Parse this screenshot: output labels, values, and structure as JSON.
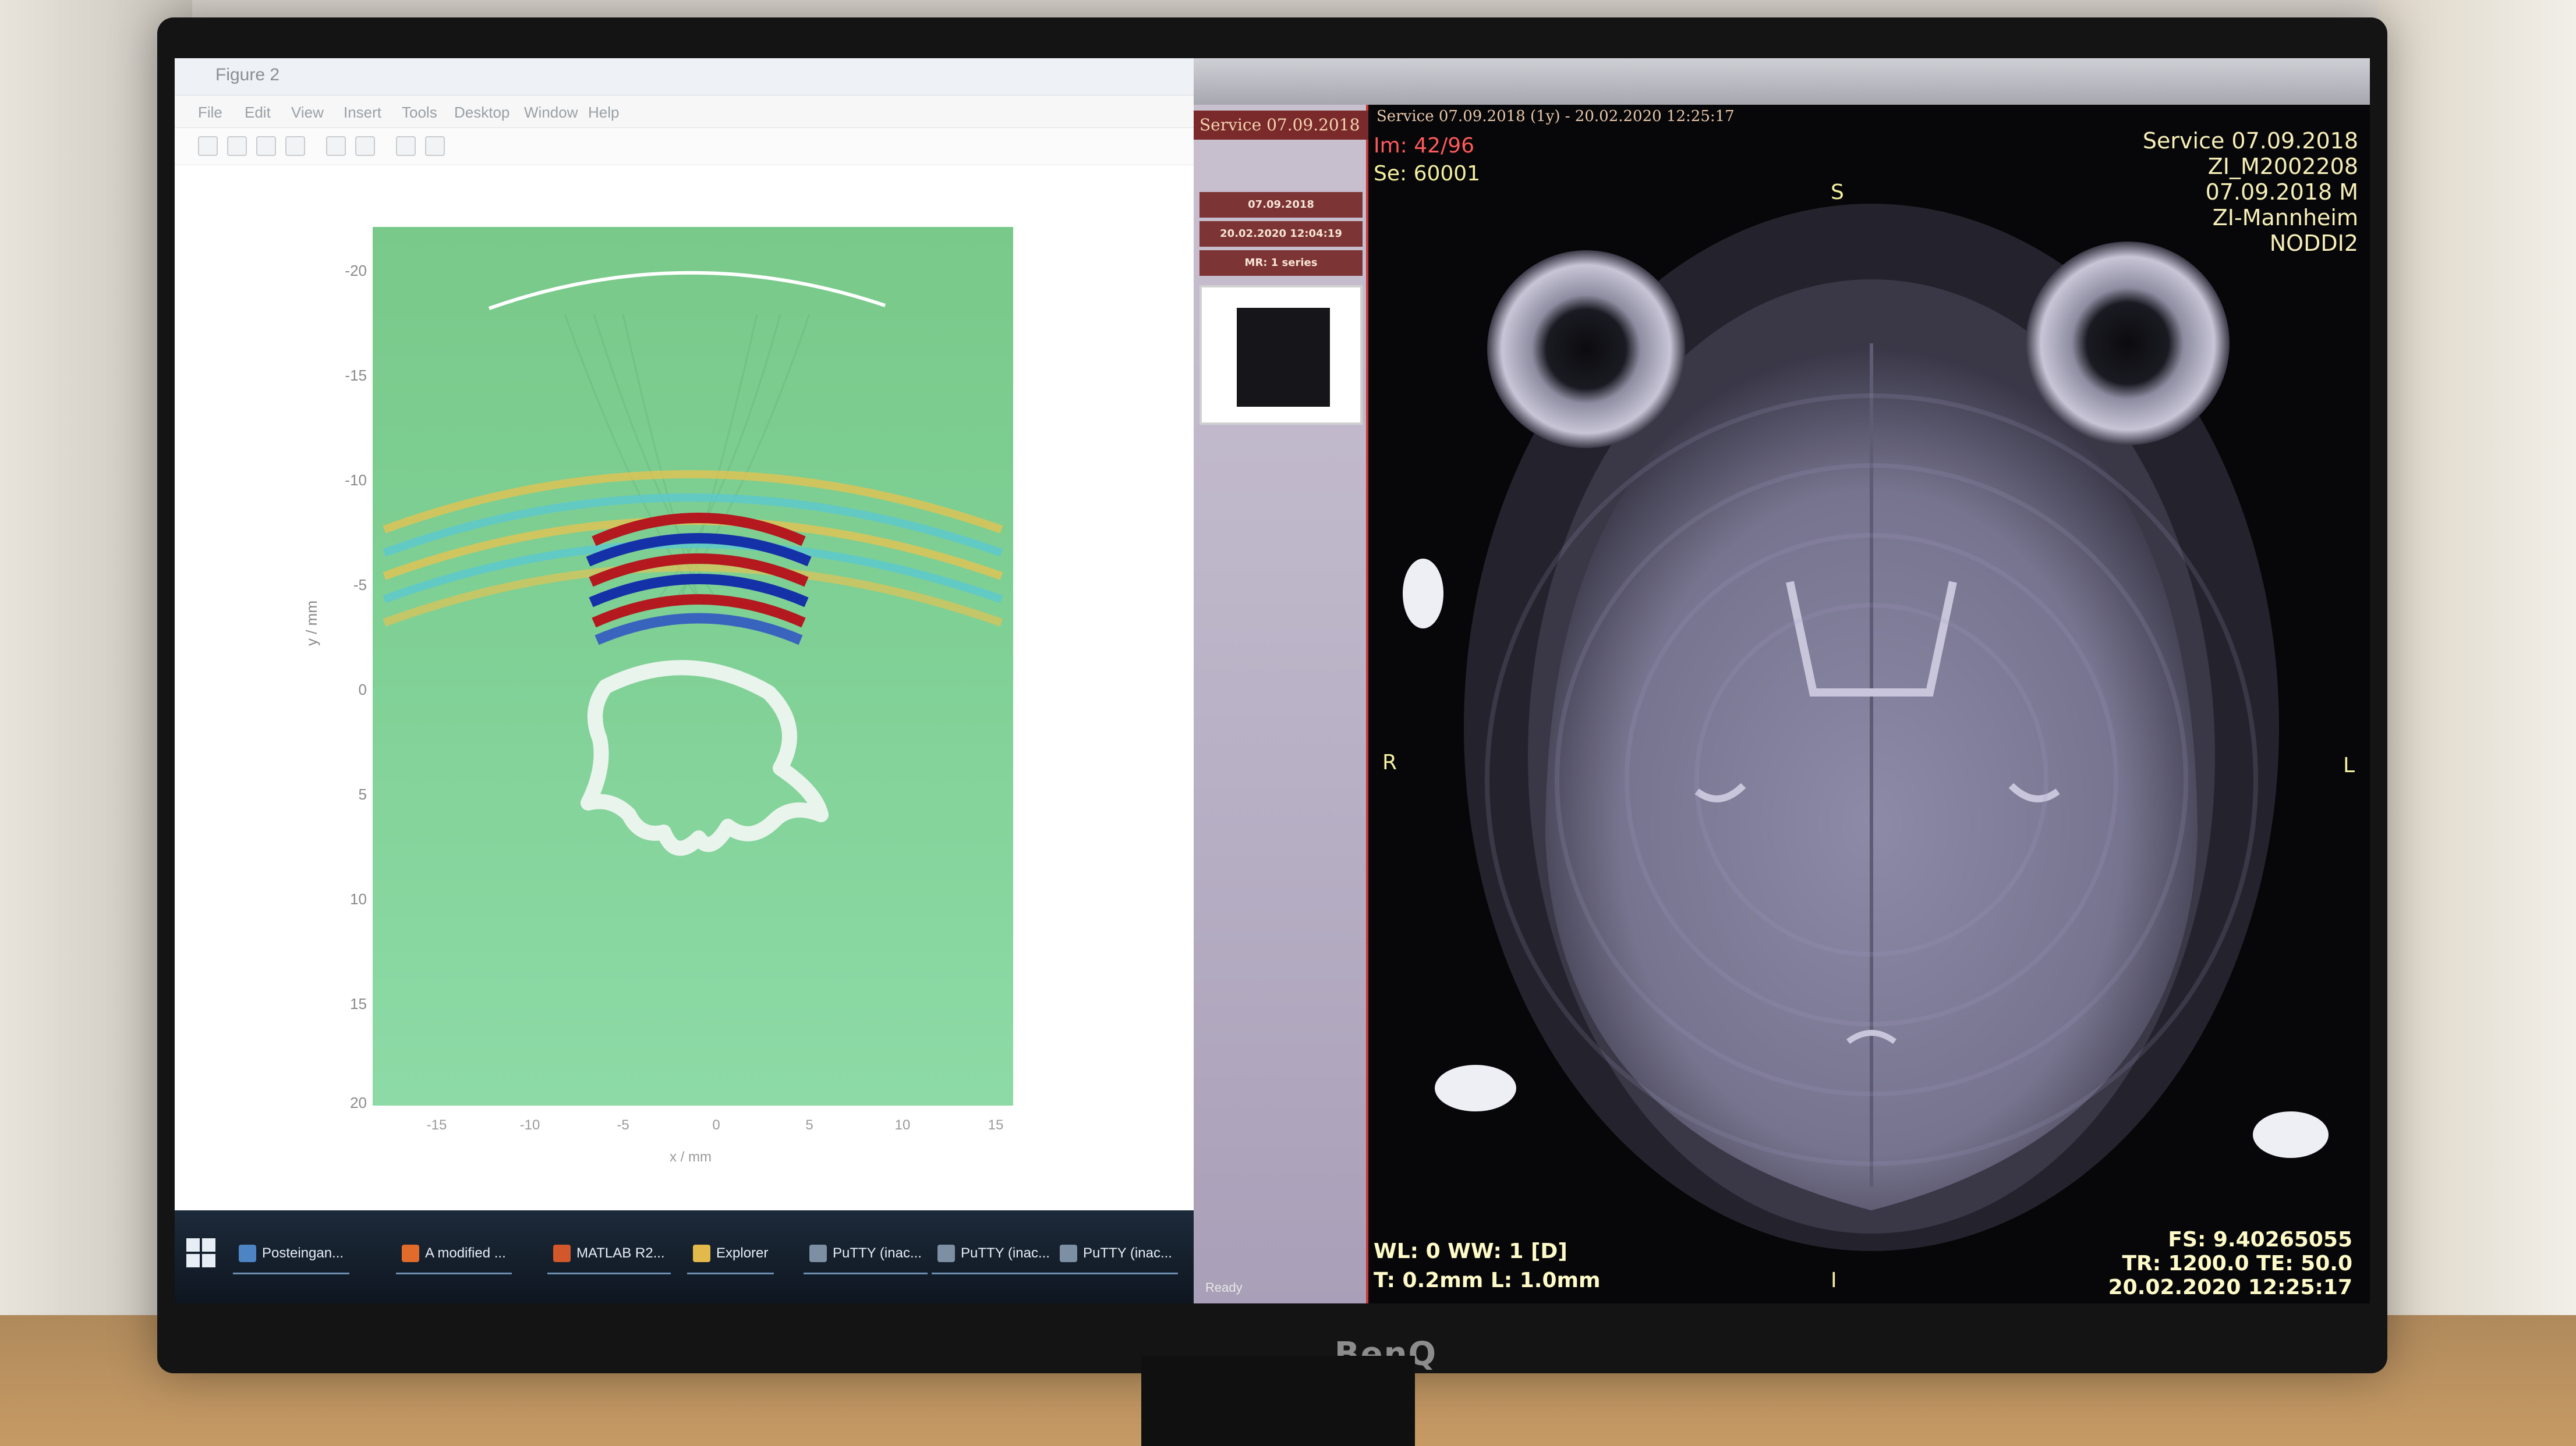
{
  "device": {
    "brand": "BenQ"
  },
  "matlab": {
    "window_title": "Figure 2",
    "menu": [
      "File",
      "Edit",
      "View",
      "Insert",
      "Tools",
      "Desktop",
      "Window",
      "Help"
    ],
    "y_ticks": [
      "-20",
      "-15",
      "-10",
      "-5",
      "0",
      "5",
      "10",
      "15",
      "20"
    ],
    "x_ticks": [
      "-15",
      "-10",
      "-5",
      "0",
      "5",
      "10",
      "15"
    ],
    "ylabel": "y / mm",
    "xlabel": "x / mm"
  },
  "taskbar": {
    "items": [
      {
        "label": "Posteingan...",
        "icon": "outlook-icon"
      },
      {
        "label": "A modified ...",
        "icon": "firefox-icon"
      },
      {
        "label": "MATLAB R2...",
        "icon": "matlab-icon"
      },
      {
        "label": "Explorer",
        "icon": "folder-icon"
      },
      {
        "label": "PuTTY (inac...",
        "icon": "putty-icon"
      },
      {
        "label": "PuTTY (inac...",
        "icon": "putty-icon"
      },
      {
        "label": "PuTTY (inac...",
        "icon": "putty-icon"
      }
    ]
  },
  "viewer": {
    "series_header": "Service 07.09.2018",
    "series_date": "07.09.2018",
    "series_time": "20.02.2020 12:04:19",
    "series_count": "MR: 1 series",
    "thumb_count": "96",
    "status": "Ready",
    "image_title": "Service 07.09.2018 (1y) - 20.02.2020 12:25:17",
    "im": "Im: 42/96",
    "se": "Se: 60001",
    "top_right": [
      "Service 07.09.2018",
      "ZI_M2002208",
      "07.09.2018 M",
      "ZI-Mannheim",
      "NODDI2"
    ],
    "orient": {
      "top": "S",
      "left": "R",
      "right": "L",
      "bottom": "I"
    },
    "wl": "WL: 0 WW: 1 [D]",
    "thickness": "T: 0.2mm L: 1.0mm",
    "fs": "FS: 9.40265055",
    "tr": "TR: 1200.0 TE: 50.0",
    "timestamp": "20.02.2020 12:25:17"
  }
}
